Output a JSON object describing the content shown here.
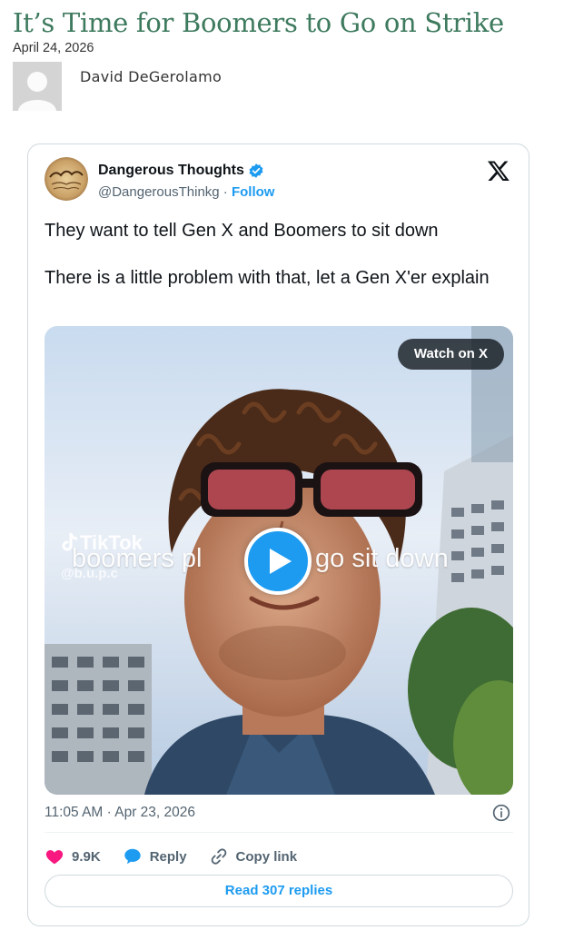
{
  "article": {
    "title": "It’s Time for Boomers to Go on Strike",
    "date": "April 24, 2026",
    "author": "David DeGerolamo"
  },
  "tweet": {
    "display_name": "Dangerous Thoughts",
    "handle": "@DangerousThinkg",
    "separator": " · ",
    "follow_label": "Follow",
    "text_line_1": "They want to tell Gen X and Boomers to sit down",
    "text_line_2": "There is a little problem with that, let a Gen X'er explain",
    "timestamp": "11:05 AM · Apr 23, 2026",
    "likes": "9.9K",
    "reply_label": "Reply",
    "copy_link_label": "Copy link",
    "read_replies_label": "Read 307 replies"
  },
  "video": {
    "watch_label": "Watch on X",
    "tiktok_brand": "TikTok",
    "tiktok_handle": "@b.u.p.c",
    "caption_left": "boomers pl",
    "caption_right": "go sit down"
  },
  "icons": {
    "verified": "verified-badge-icon",
    "x_logo": "x-logo-icon",
    "play": "play-icon",
    "info": "info-icon",
    "heart": "heart-icon",
    "reply": "reply-bubble-icon",
    "link": "link-icon"
  },
  "colors": {
    "title": "#3e7a5e",
    "accent": "#1d9bf0",
    "like": "#f91880",
    "muted": "#536471",
    "border": "#cfd9de"
  }
}
